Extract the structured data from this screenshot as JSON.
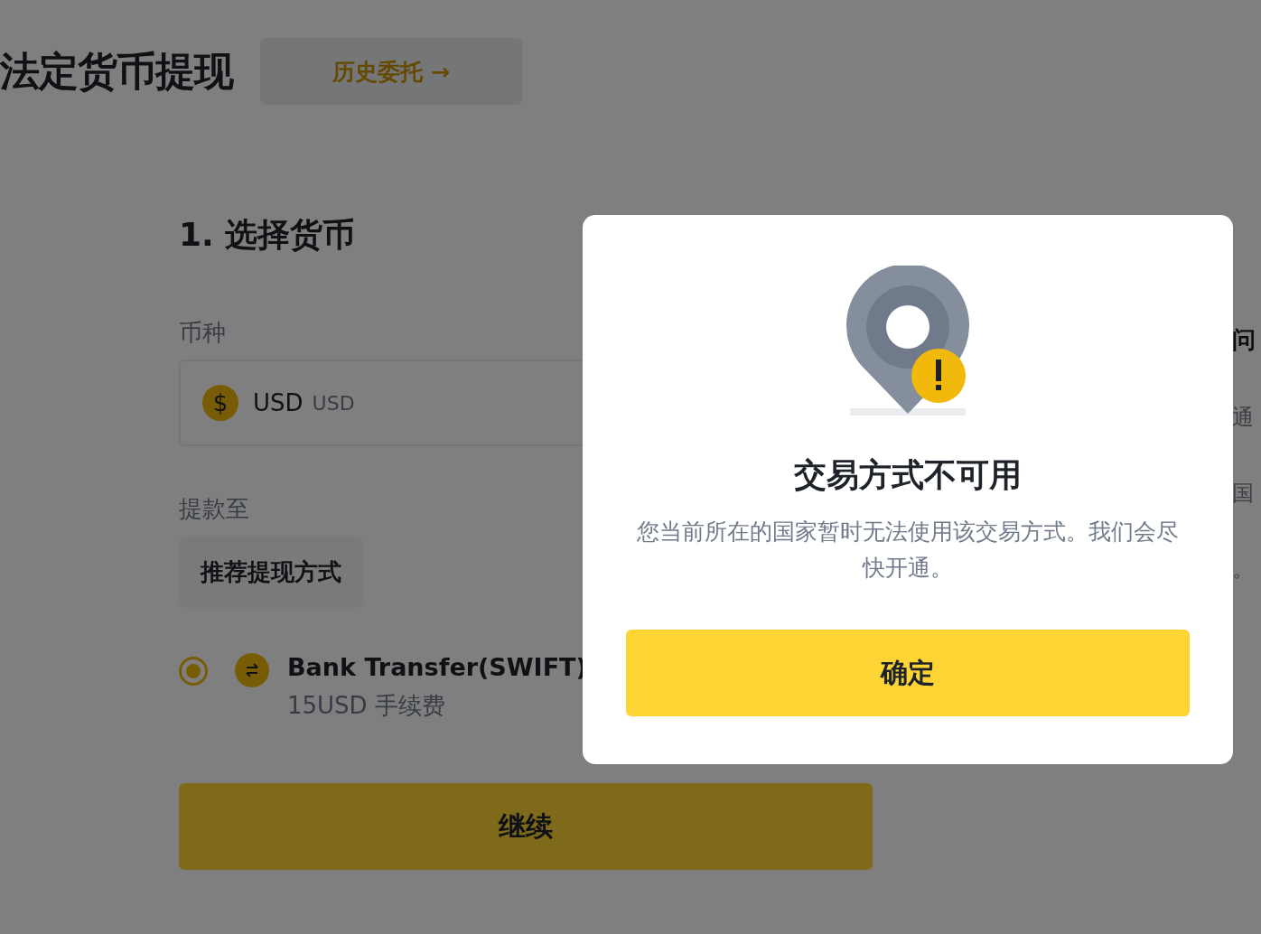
{
  "page_title": "法定货币提现",
  "history_button": {
    "label": "历史委托",
    "arrow": "→"
  },
  "step_title": "1. 选择货币",
  "currency": {
    "label": "币种",
    "symbol": "$",
    "value": "USD",
    "code": "USD"
  },
  "withdraw_to": {
    "label": "提款至",
    "method_tab": "推荐提现方式"
  },
  "methods": [
    {
      "name": "Bank Transfer(SWIFT)",
      "fee": "15USD 手续费",
      "selected": true
    }
  ],
  "continue_button": "继续",
  "side_panel": [
    "问",
    "通",
    "国",
    "。"
  ],
  "dialog": {
    "title": "交易方式不可用",
    "message": "您当前所在的国家暂时无法使用该交易方式。我们会尽快开通。",
    "button": "确定"
  }
}
